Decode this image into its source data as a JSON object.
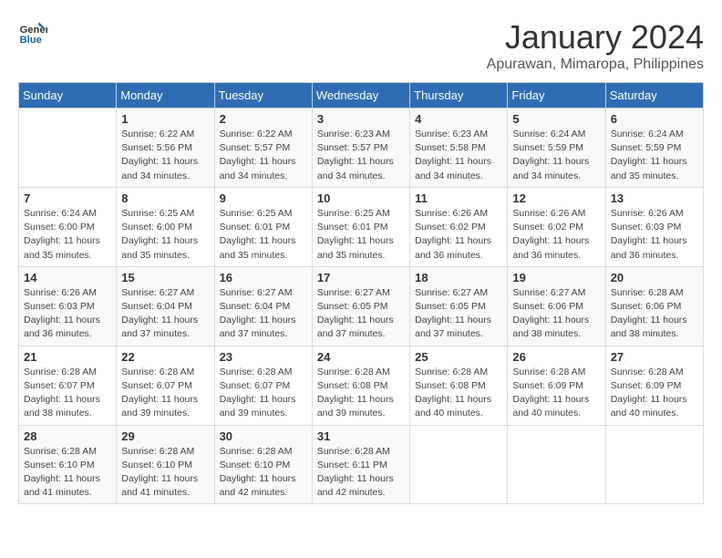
{
  "header": {
    "logo_line1": "General",
    "logo_line2": "Blue",
    "title": "January 2024",
    "subtitle": "Apurawan, Mimaropa, Philippines"
  },
  "days_of_week": [
    "Sunday",
    "Monday",
    "Tuesday",
    "Wednesday",
    "Thursday",
    "Friday",
    "Saturday"
  ],
  "weeks": [
    [
      {
        "num": "",
        "info": ""
      },
      {
        "num": "1",
        "info": "Sunrise: 6:22 AM\nSunset: 5:56 PM\nDaylight: 11 hours\nand 34 minutes."
      },
      {
        "num": "2",
        "info": "Sunrise: 6:22 AM\nSunset: 5:57 PM\nDaylight: 11 hours\nand 34 minutes."
      },
      {
        "num": "3",
        "info": "Sunrise: 6:23 AM\nSunset: 5:57 PM\nDaylight: 11 hours\nand 34 minutes."
      },
      {
        "num": "4",
        "info": "Sunrise: 6:23 AM\nSunset: 5:58 PM\nDaylight: 11 hours\nand 34 minutes."
      },
      {
        "num": "5",
        "info": "Sunrise: 6:24 AM\nSunset: 5:59 PM\nDaylight: 11 hours\nand 34 minutes."
      },
      {
        "num": "6",
        "info": "Sunrise: 6:24 AM\nSunset: 5:59 PM\nDaylight: 11 hours\nand 35 minutes."
      }
    ],
    [
      {
        "num": "7",
        "info": "Sunrise: 6:24 AM\nSunset: 6:00 PM\nDaylight: 11 hours\nand 35 minutes."
      },
      {
        "num": "8",
        "info": "Sunrise: 6:25 AM\nSunset: 6:00 PM\nDaylight: 11 hours\nand 35 minutes."
      },
      {
        "num": "9",
        "info": "Sunrise: 6:25 AM\nSunset: 6:01 PM\nDaylight: 11 hours\nand 35 minutes."
      },
      {
        "num": "10",
        "info": "Sunrise: 6:25 AM\nSunset: 6:01 PM\nDaylight: 11 hours\nand 35 minutes."
      },
      {
        "num": "11",
        "info": "Sunrise: 6:26 AM\nSunset: 6:02 PM\nDaylight: 11 hours\nand 36 minutes."
      },
      {
        "num": "12",
        "info": "Sunrise: 6:26 AM\nSunset: 6:02 PM\nDaylight: 11 hours\nand 36 minutes."
      },
      {
        "num": "13",
        "info": "Sunrise: 6:26 AM\nSunset: 6:03 PM\nDaylight: 11 hours\nand 36 minutes."
      }
    ],
    [
      {
        "num": "14",
        "info": "Sunrise: 6:26 AM\nSunset: 6:03 PM\nDaylight: 11 hours\nand 36 minutes."
      },
      {
        "num": "15",
        "info": "Sunrise: 6:27 AM\nSunset: 6:04 PM\nDaylight: 11 hours\nand 37 minutes."
      },
      {
        "num": "16",
        "info": "Sunrise: 6:27 AM\nSunset: 6:04 PM\nDaylight: 11 hours\nand 37 minutes."
      },
      {
        "num": "17",
        "info": "Sunrise: 6:27 AM\nSunset: 6:05 PM\nDaylight: 11 hours\nand 37 minutes."
      },
      {
        "num": "18",
        "info": "Sunrise: 6:27 AM\nSunset: 6:05 PM\nDaylight: 11 hours\nand 37 minutes."
      },
      {
        "num": "19",
        "info": "Sunrise: 6:27 AM\nSunset: 6:06 PM\nDaylight: 11 hours\nand 38 minutes."
      },
      {
        "num": "20",
        "info": "Sunrise: 6:28 AM\nSunset: 6:06 PM\nDaylight: 11 hours\nand 38 minutes."
      }
    ],
    [
      {
        "num": "21",
        "info": "Sunrise: 6:28 AM\nSunset: 6:07 PM\nDaylight: 11 hours\nand 38 minutes."
      },
      {
        "num": "22",
        "info": "Sunrise: 6:28 AM\nSunset: 6:07 PM\nDaylight: 11 hours\nand 39 minutes."
      },
      {
        "num": "23",
        "info": "Sunrise: 6:28 AM\nSunset: 6:07 PM\nDaylight: 11 hours\nand 39 minutes."
      },
      {
        "num": "24",
        "info": "Sunrise: 6:28 AM\nSunset: 6:08 PM\nDaylight: 11 hours\nand 39 minutes."
      },
      {
        "num": "25",
        "info": "Sunrise: 6:28 AM\nSunset: 6:08 PM\nDaylight: 11 hours\nand 40 minutes."
      },
      {
        "num": "26",
        "info": "Sunrise: 6:28 AM\nSunset: 6:09 PM\nDaylight: 11 hours\nand 40 minutes."
      },
      {
        "num": "27",
        "info": "Sunrise: 6:28 AM\nSunset: 6:09 PM\nDaylight: 11 hours\nand 40 minutes."
      }
    ],
    [
      {
        "num": "28",
        "info": "Sunrise: 6:28 AM\nSunset: 6:10 PM\nDaylight: 11 hours\nand 41 minutes."
      },
      {
        "num": "29",
        "info": "Sunrise: 6:28 AM\nSunset: 6:10 PM\nDaylight: 11 hours\nand 41 minutes."
      },
      {
        "num": "30",
        "info": "Sunrise: 6:28 AM\nSunset: 6:10 PM\nDaylight: 11 hours\nand 42 minutes."
      },
      {
        "num": "31",
        "info": "Sunrise: 6:28 AM\nSunset: 6:11 PM\nDaylight: 11 hours\nand 42 minutes."
      },
      {
        "num": "",
        "info": ""
      },
      {
        "num": "",
        "info": ""
      },
      {
        "num": "",
        "info": ""
      }
    ]
  ]
}
